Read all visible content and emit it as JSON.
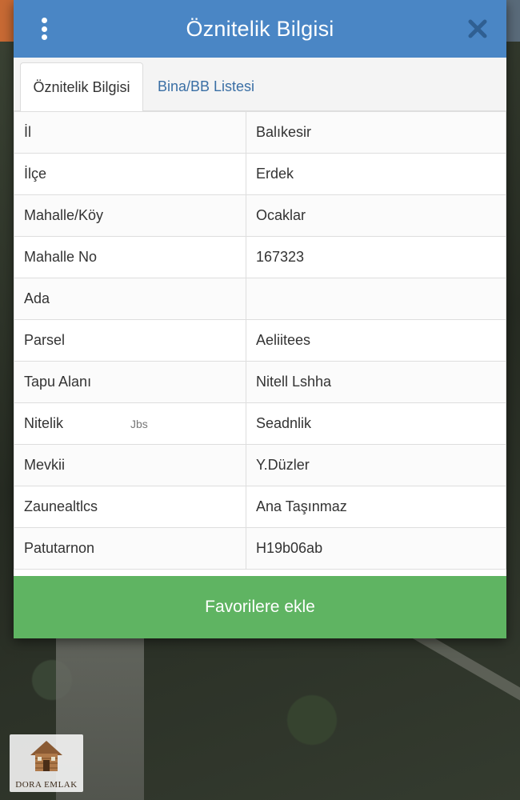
{
  "dialog": {
    "title": "Öznitelik Bilgisi",
    "menu_icon": "more-vertical-icon",
    "close_icon": "close-icon"
  },
  "tabs": [
    {
      "label": "Öznitelik Bilgisi",
      "active": true
    },
    {
      "label": "Bina/BB Listesi",
      "active": false
    }
  ],
  "attributes": [
    {
      "key": "İl",
      "value": "Balıkesir"
    },
    {
      "key": "İlçe",
      "value": "Erdek"
    },
    {
      "key": "Mahalle/Köy",
      "value": "Ocaklar"
    },
    {
      "key": "Mahalle No",
      "value": "167323"
    },
    {
      "key": "Ada",
      "value": ""
    },
    {
      "key": "Parsel",
      "value": "Aeliitees"
    },
    {
      "key": "Tapu Alanı",
      "value": "Nitell Lshha"
    },
    {
      "key": "Nitelik",
      "value": "Seadnlik",
      "key_extra": "Jbs"
    },
    {
      "key": "Mevkii",
      "value": "Y.Düzler"
    },
    {
      "key": "Zaunealtlcs",
      "value": "Ana Taşınmaz"
    },
    {
      "key": "Patutarnon",
      "value": "H19b06ab"
    }
  ],
  "actions": {
    "favorite_label": "Favorilere ekle"
  },
  "watermark": {
    "text": "DORA EMLAK"
  },
  "colors": {
    "header": "#4a86c5",
    "tab_link": "#3a6fa5",
    "favorite_button": "#5fb462"
  }
}
